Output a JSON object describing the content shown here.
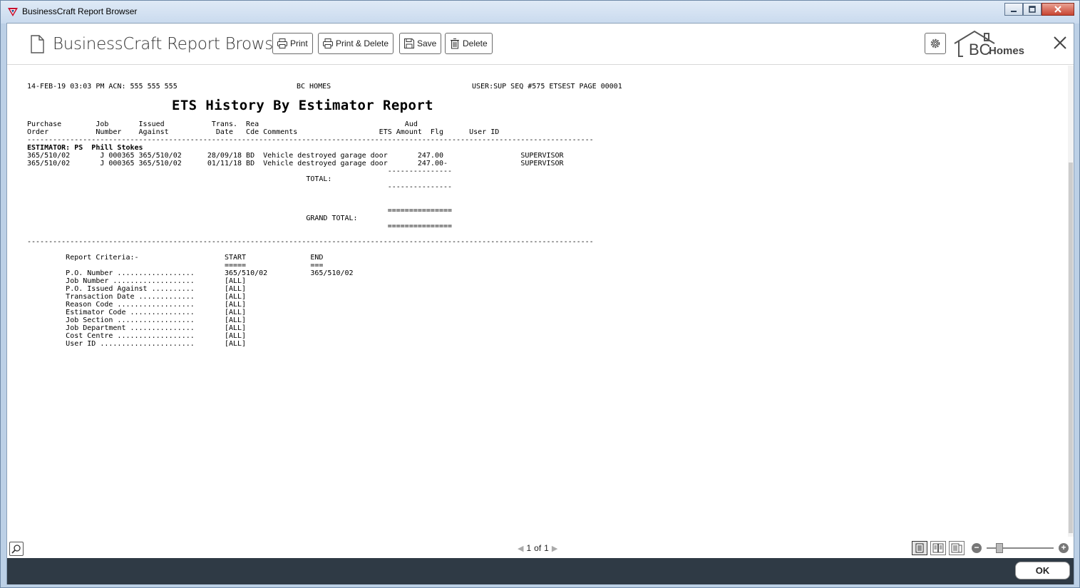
{
  "window": {
    "title": "BusinessCraft Report Browser"
  },
  "header": {
    "app_title": "BusinessCraft Report Browser",
    "buttons": {
      "print": "Print",
      "print_delete": "Print & Delete",
      "save": "Save",
      "delete": "Delete"
    },
    "logo": {
      "bc": "BC",
      "homes": "Homes"
    }
  },
  "report": {
    "header_left": "14-FEB-19 03:03 PM ACN: 555 555 555",
    "header_center": "BC HOMES",
    "header_right": "USER:SUP SEQ #575 ETSEST PAGE 00001",
    "title": "ETS History By Estimator Report",
    "col_headers_1": "Purchase        Job       Issued           Trans.  Rea                                  Aud",
    "col_headers_2": "Order           Number    Against           Date   Cde Comments                   ETS Amount  Flg      User ID",
    "separator": "------------------------------------------------------------------------------------------------------------------------------------",
    "estimator_line": "ESTIMATOR: PS  Phill Stokes",
    "rows": [
      "365/510/02       J 000365 365/510/02      28/09/18 BD  Vehicle destroyed garage door       247.00                  SUPERVISOR",
      "365/510/02       J 000365 365/510/02      01/11/18 BD  Vehicle destroyed garage door       247.00-                 SUPERVISOR"
    ],
    "totals_block": "                                                                                    ---------------\n                                                                 TOTAL:\n                                                                                    ---------------\n\n\n                                                                                    ===============\n                                                                 GRAND TOTAL:\n                                                                                    ===============",
    "criteria_block": "         Report Criteria:-                    START               END\n                                              =====               ===\n         P.O. Number ..................       365/510/02          365/510/02\n         Job Number ...................       [ALL]\n         P.O. Issued Against ..........       [ALL]\n         Transaction Date .............       [ALL]\n         Reason Code ..................       [ALL]\n         Estimator Code ...............       [ALL]\n         Job Section ..................       [ALL]\n         Job Department ...............       [ALL]\n         Cost Centre ..................       [ALL]\n         User ID ......................       [ALL]"
  },
  "footer": {
    "page_current": "1",
    "page_of": "of",
    "page_total": "1",
    "ok": "OK"
  },
  "colors": {
    "bottom_bar": "#2f3a45",
    "title_bar": "#c9daee",
    "close_button": "#c84532"
  },
  "icons": [
    "app-logo-icon",
    "minimize-icon",
    "maximize-icon",
    "close-window-icon",
    "document-icon",
    "printer-icon",
    "floppy-disk-icon",
    "trash-icon",
    "gear-icon",
    "close-icon",
    "magnifier-icon",
    "chevron-left-icon",
    "chevron-right-icon",
    "single-page-icon",
    "two-page-icon",
    "multi-page-icon",
    "minus-icon",
    "plus-icon"
  ]
}
